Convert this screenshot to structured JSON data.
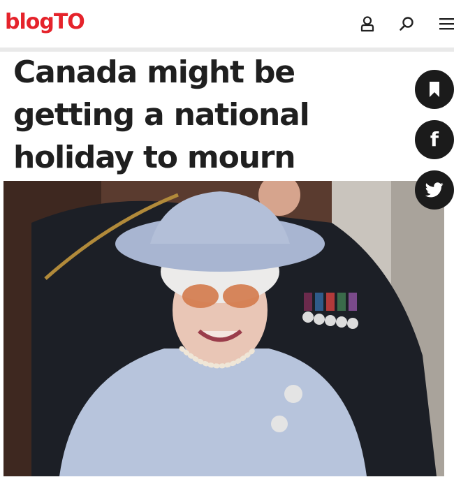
{
  "site": {
    "logo_text": "blogTO",
    "brand_color": "#e5232b"
  },
  "header": {
    "icons": [
      "account-icon",
      "search-icon",
      "menu-icon"
    ]
  },
  "article": {
    "headline": "Canada might be getting a national holiday to mourn Queen Elizabeth II"
  },
  "share": {
    "buttons": [
      "bookmark-icon",
      "facebook-icon",
      "twitter-icon"
    ],
    "button_color": "#1b1b1b"
  }
}
